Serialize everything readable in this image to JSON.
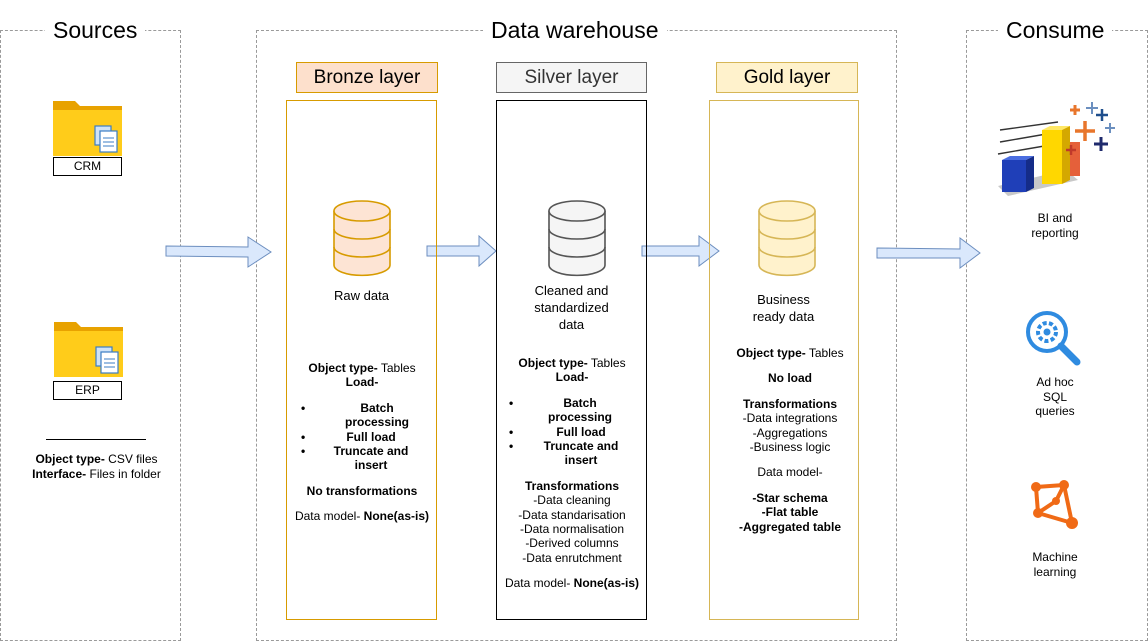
{
  "groups": {
    "sources": "Sources",
    "warehouse": "Data warehouse",
    "consume": "Consume"
  },
  "sources": {
    "crm": "CRM",
    "erp": "ERP",
    "object_type_label": "Object type-",
    "object_type_value": " CSV files",
    "interface_label": "Interface-",
    "interface_value": " Files in folder"
  },
  "bronze": {
    "title": "Bronze layer",
    "caption": "Raw data",
    "object_type_label": "Object type-",
    "object_type_value": " Tables",
    "load_label": "Load-",
    "load_items": [
      "Batch processing",
      "Full load",
      "Truncate and insert"
    ],
    "transformations": "No transformations",
    "data_model_label": "Data model- ",
    "data_model_value": "None(as-is)",
    "colors": {
      "title_bg": "#fde0cc",
      "title_border": "#d79b00",
      "box_border": "#d79b00",
      "cylinder_fill": "#fde4d4",
      "cylinder_stroke": "#d79b00"
    }
  },
  "silver": {
    "title": "Silver layer",
    "caption_lines": [
      "Cleaned and",
      "standardized",
      "data"
    ],
    "object_type_label": "Object type-",
    "object_type_value": " Tables",
    "load_label": "Load-",
    "load_items": [
      "Batch processing",
      "Full load",
      "Truncate and insert"
    ],
    "transformations_label": "Transformations",
    "transformations": [
      "-Data cleaning",
      "-Data standarisation",
      "-Data normalisation",
      "-Derived columns",
      "-Data enrutchment"
    ],
    "data_model_label": "Data model- ",
    "data_model_value": "None(as-is)",
    "colors": {
      "title_bg": "#f5f5f5",
      "title_border": "#666666",
      "box_border": "#000000",
      "cylinder_fill": "#f5f5f5",
      "cylinder_stroke": "#555555"
    }
  },
  "gold": {
    "title": "Gold layer",
    "caption_lines": [
      "Business",
      "ready data"
    ],
    "object_type_label": "Object type-",
    "object_type_value": " Tables",
    "load": "No load",
    "transformations_label": "Transformations",
    "transformations": [
      "-Data integrations",
      "-Aggregations",
      "-Business logic"
    ],
    "data_model_label": "Data model-",
    "data_models": [
      "-Star schema",
      "-Flat table",
      "-Aggregated table"
    ],
    "colors": {
      "title_bg": "#fff2cc",
      "title_border": "#d6b656",
      "box_border": "#d6b656",
      "cylinder_fill": "#fff2cc",
      "cylinder_stroke": "#d6b656"
    }
  },
  "consume": {
    "bi_lines": [
      "BI and",
      "reporting"
    ],
    "adhoc_lines": [
      "Ad hoc",
      "SQL",
      "queries"
    ],
    "ml_lines": [
      "Machine",
      "learning"
    ]
  },
  "icons": [
    "folder-icon",
    "bar-chart-icon",
    "search-gear-icon",
    "graph-node-icon",
    "database-icon",
    "arrow-right-icon"
  ],
  "colors": {
    "arrow_fill": "#dae8fc",
    "arrow_stroke": "#6c8ebf",
    "group_border": "#9a9a9a"
  }
}
